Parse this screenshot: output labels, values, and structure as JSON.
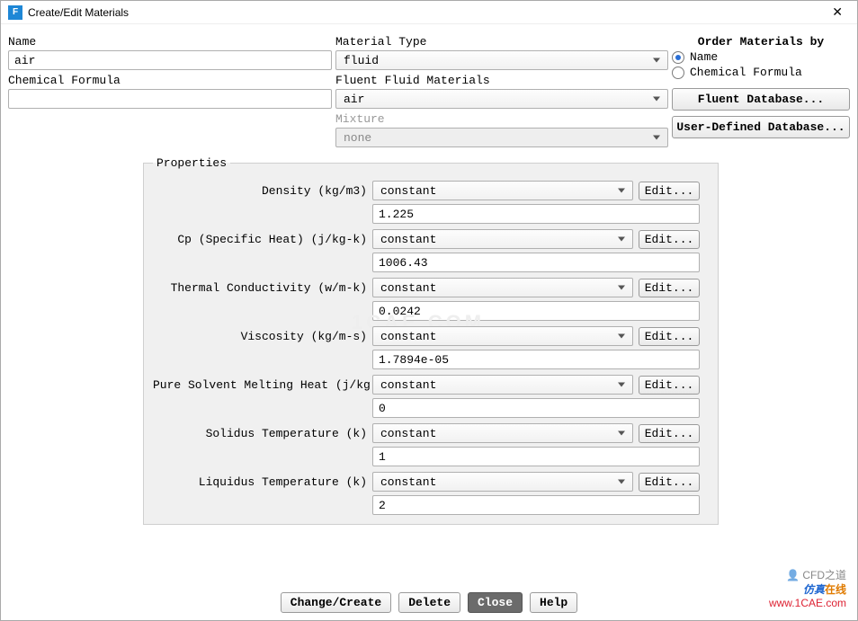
{
  "title": "Create/Edit Materials",
  "left": {
    "name_label": "Name",
    "name_value": "air",
    "formula_label": "Chemical Formula",
    "formula_value": ""
  },
  "mid": {
    "type_label": "Material Type",
    "type_value": "fluid",
    "fluid_label": "Fluent Fluid Materials",
    "fluid_value": "air",
    "mixture_label": "Mixture",
    "mixture_value": "none"
  },
  "right": {
    "order_label": "Order Materials by",
    "radio_name": "Name",
    "radio_formula": "Chemical Formula",
    "btn_fluent_db": "Fluent Database...",
    "btn_user_db": "User-Defined Database..."
  },
  "properties": {
    "legend": "Properties",
    "constant": "constant",
    "edit": "Edit...",
    "rows": [
      {
        "label": "Density (kg/m3)",
        "value": "1.225"
      },
      {
        "label": "Cp (Specific Heat) (j/kg-k)",
        "value": "1006.43"
      },
      {
        "label": "Thermal Conductivity (w/m-k)",
        "value": "0.0242"
      },
      {
        "label": "Viscosity (kg/m-s)",
        "value": "1.7894e-05"
      },
      {
        "label": "Pure Solvent Melting Heat (j/kg)",
        "value": "0"
      },
      {
        "label": "Solidus Temperature (k)",
        "value": "1"
      },
      {
        "label": "Liquidus Temperature (k)",
        "value": "2"
      }
    ]
  },
  "buttons": {
    "change": "Change/Create",
    "delete": "Delete",
    "close": "Close",
    "help": "Help"
  },
  "watermark": {
    "line1": "CFD之道",
    "line2a": "仿真",
    "line2b": "在线",
    "url": "www.1CAE.com"
  }
}
